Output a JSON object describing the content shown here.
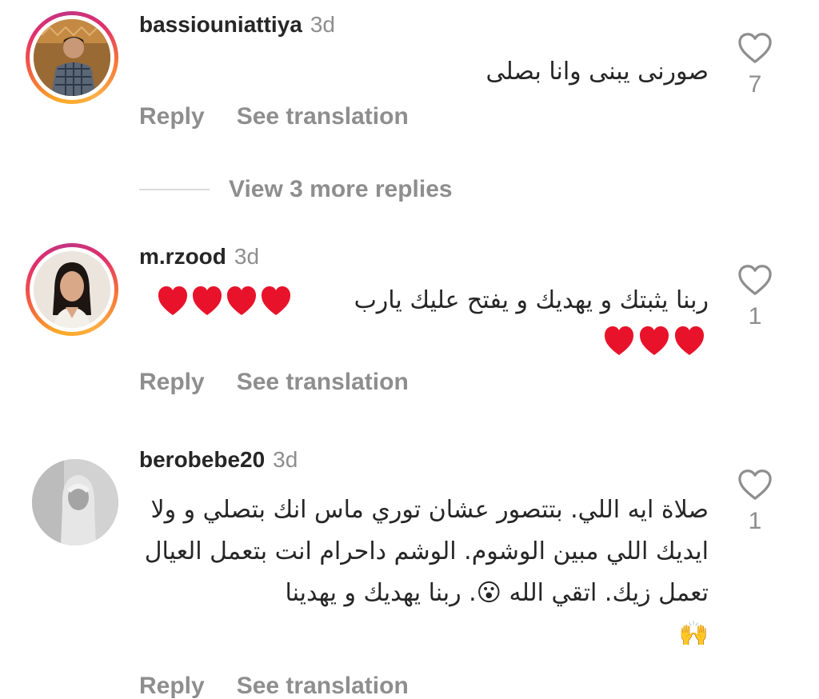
{
  "comments": [
    {
      "username": "bassiouniattiya",
      "time": "3d",
      "text": "صورنى يبنى وانا بصلى",
      "emoji": "",
      "text2": "",
      "likes": "7",
      "has_story": true
    },
    {
      "username": "m.rzood",
      "time": "3d",
      "text": "ربنا يثبتك و يهديك و يفتح عليك يارب",
      "emoji": "❤️❤️❤️❤️❤️❤️❤️",
      "text2": "",
      "likes": "1",
      "has_story": true
    },
    {
      "username": "berobebe20",
      "time": "3d",
      "text": "صلاة ايه اللي. بتتصور عشان توري ماس انك بتصلي و ولا ايديك اللي مبين الوشوم. الوشم داحرام انت بتعمل العيال تعمل زيك. اتقي الله 😮. ربنا يهديك و يهدينا",
      "emoji": "🙌",
      "text2": "",
      "likes": "1",
      "has_story": false
    }
  ],
  "actions": {
    "reply": "Reply",
    "see_translation": "See translation"
  },
  "view_more": "View 3 more replies",
  "icons": {
    "like": "heart-outline-icon"
  },
  "colors": {
    "muted": "#8e8e8e",
    "text": "#262626",
    "heart": "#e8132b"
  }
}
